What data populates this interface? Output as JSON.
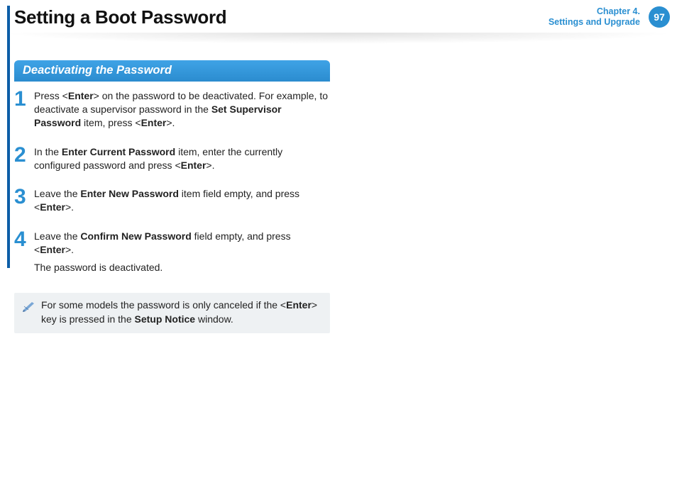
{
  "header": {
    "title": "Setting a Boot Password",
    "chapter_line1": "Chapter 4.",
    "chapter_line2": "Settings and Upgrade",
    "page_number": "97"
  },
  "section": {
    "heading": "Deactivating the Password"
  },
  "steps": [
    {
      "num": "1",
      "parts": [
        "Press <",
        "Enter",
        "> on the password to be deactivated. For example, to deactivate a supervisor password in the ",
        "Set Supervisor Password",
        " item, press <",
        "Enter",
        ">."
      ]
    },
    {
      "num": "2",
      "parts": [
        "In the ",
        "Enter Current Password",
        " item, enter the currently configured password and press <",
        "Enter",
        ">."
      ]
    },
    {
      "num": "3",
      "parts": [
        "Leave the ",
        "Enter New Password",
        " item field empty, and press <",
        "Enter",
        ">."
      ]
    },
    {
      "num": "4",
      "parts": [
        "Leave the ",
        "Confirm New Password",
        " field empty, and press <",
        "Enter",
        ">."
      ],
      "trailer": "The password is deactivated."
    }
  ],
  "note": {
    "parts": [
      "For some models the password is only canceled if the <",
      "Enter",
      "> key is pressed in the ",
      "Setup Notice",
      " window."
    ]
  }
}
